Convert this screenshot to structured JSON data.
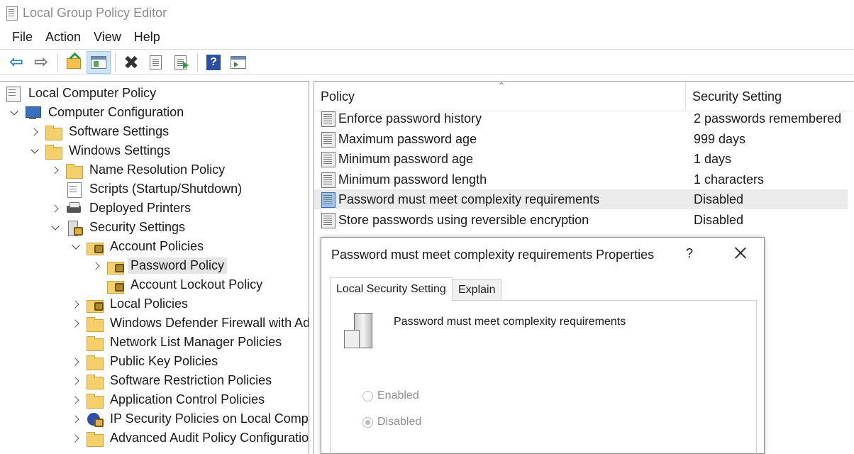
{
  "window": {
    "title": "Local Group Policy Editor"
  },
  "menu": [
    "File",
    "Action",
    "View",
    "Help"
  ],
  "toolbar": {
    "buttons": [
      "back-icon",
      "forward-icon",
      "up-folder-icon",
      "show-hide-tree-icon",
      "delete-icon",
      "properties-icon",
      "export-list-icon",
      "help-icon",
      "show-action-pane-icon"
    ]
  },
  "tree": [
    {
      "label": "Local Computer Policy",
      "level": 0,
      "chevron": "none",
      "icon": "sheet"
    },
    {
      "label": "Computer Configuration",
      "level": 1,
      "chevron": "down",
      "icon": "computer"
    },
    {
      "label": "Software Settings",
      "level": 2,
      "chevron": "right",
      "icon": "folder"
    },
    {
      "label": "Windows Settings",
      "level": 2,
      "chevron": "down",
      "icon": "folder"
    },
    {
      "label": "Name Resolution Policy",
      "level": 3,
      "chevron": "right",
      "icon": "folder"
    },
    {
      "label": "Scripts (Startup/Shutdown)",
      "level": 3,
      "chevron": "none",
      "icon": "doc"
    },
    {
      "label": "Deployed Printers",
      "level": 3,
      "chevron": "right",
      "icon": "printer"
    },
    {
      "label": "Security Settings",
      "level": 3,
      "chevron": "down",
      "icon": "security"
    },
    {
      "label": "Account Policies",
      "level": 4,
      "chevron": "down",
      "icon": "lock-folder"
    },
    {
      "label": "Password Policy",
      "level": 5,
      "chevron": "right",
      "icon": "lock-folder",
      "selected": true
    },
    {
      "label": "Account Lockout Policy",
      "level": 5,
      "chevron": "none",
      "icon": "lock-folder"
    },
    {
      "label": "Local Policies",
      "level": 4,
      "chevron": "right",
      "icon": "lock-folder"
    },
    {
      "label": "Windows Defender Firewall with Adv",
      "level": 4,
      "chevron": "right",
      "icon": "folder"
    },
    {
      "label": "Network List Manager Policies",
      "level": 4,
      "chevron": "none",
      "icon": "folder"
    },
    {
      "label": "Public Key Policies",
      "level": 4,
      "chevron": "right",
      "icon": "folder"
    },
    {
      "label": "Software Restriction Policies",
      "level": 4,
      "chevron": "right",
      "icon": "folder"
    },
    {
      "label": "Application Control Policies",
      "level": 4,
      "chevron": "right",
      "icon": "folder"
    },
    {
      "label": "IP Security Policies on Local Comput",
      "level": 4,
      "chevron": "right",
      "icon": "ipsec"
    },
    {
      "label": "Advanced Audit Policy Configuratio",
      "level": 4,
      "chevron": "right",
      "icon": "folder"
    }
  ],
  "list": {
    "columns": {
      "policy": "Policy",
      "setting": "Security Setting"
    },
    "rows": [
      {
        "policy": "Enforce password history",
        "setting": "2 passwords remembered"
      },
      {
        "policy": "Maximum password age",
        "setting": "999 days"
      },
      {
        "policy": "Minimum password age",
        "setting": "1 days"
      },
      {
        "policy": "Minimum password length",
        "setting": "1 characters"
      },
      {
        "policy": "Password must meet complexity requirements",
        "setting": "Disabled",
        "highlighted": true
      },
      {
        "policy": "Store passwords using reversible encryption",
        "setting": "Disabled"
      }
    ]
  },
  "dialog": {
    "title": "Password must meet complexity requirements Properties",
    "help_glyph": "?",
    "tabs": [
      "Local Security Setting",
      "Explain"
    ],
    "policy_name": "Password must meet complexity requirements",
    "options": [
      {
        "label": "Enabled",
        "checked": false
      },
      {
        "label": "Disabled",
        "checked": true
      }
    ]
  }
}
